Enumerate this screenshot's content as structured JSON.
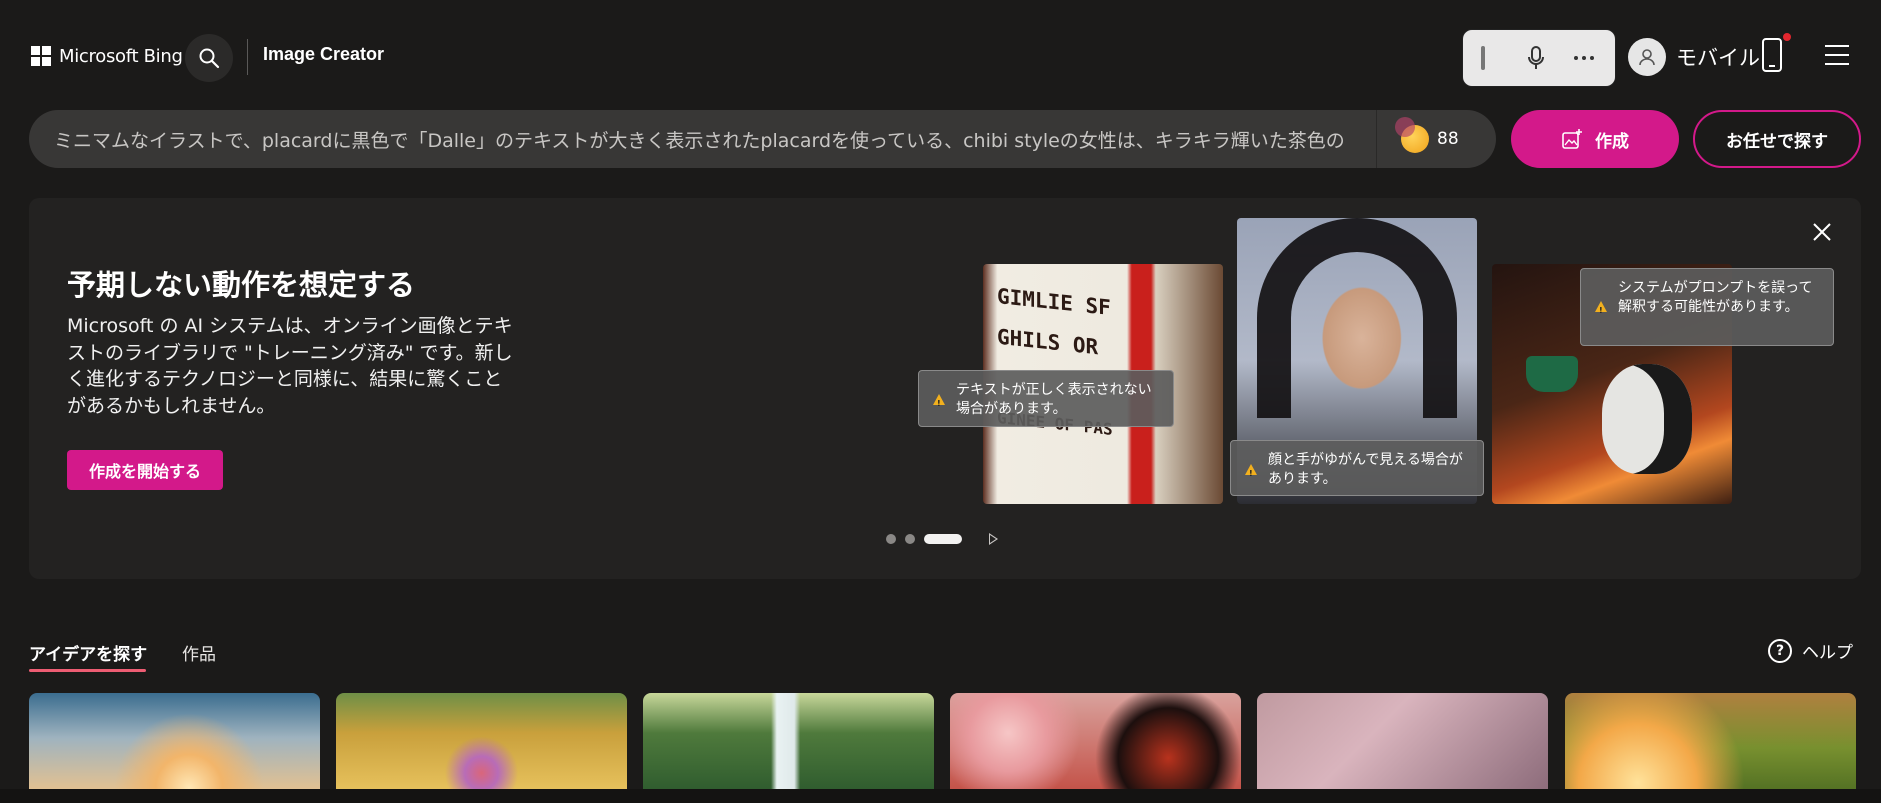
{
  "header": {
    "brand": "Microsoft Bing",
    "product": "Image Creator",
    "user_label": "モバイル"
  },
  "prompt_bar": {
    "text": "ミニマムなイラストで、placardに黒色で「Dalle」のテキストが大きく表示されたplacardを使っている、chibi styleの女性は、キラキラ輝いた茶色の",
    "boost_count": "88",
    "create_label": "作成",
    "surprise_label": "お任せで探す"
  },
  "hero": {
    "title": "予期しない動作を想定する",
    "body": "Microsoft の AI システムは、オンライン画像とテキストのライブラリで \"トレーニング済み\" です。新しく進化するテクノロジーと同様に、結果に驚くことがあるかもしれません。",
    "cta": "作成を開始する",
    "callouts": [
      "テキストが正しく表示されない場合があります。",
      "顔と手がゆがんで見える場合があります。",
      "システムがプロンプトを誤って解釈する可能性があります。"
    ],
    "sample_text": [
      "GIMLIE SF",
      "GHILS OR",
      "GINEE OF PAS"
    ],
    "carousel": {
      "count": 3,
      "active_index": 2
    }
  },
  "tabs": [
    {
      "label": "アイデアを探す",
      "active": true
    },
    {
      "label": "作品",
      "active": false
    }
  ],
  "help_label": "ヘルプ",
  "colors": {
    "accent": "#d3198a",
    "tab_underline": "#ee5d73",
    "background": "#1b1a19",
    "panel": "#232221"
  },
  "icons": [
    "windows-logo-icon",
    "search-icon",
    "microphone-icon",
    "more-icon",
    "user-icon",
    "phone-icon",
    "menu-icon",
    "image-create-icon",
    "coin-icon",
    "close-icon",
    "warning-icon",
    "play-icon",
    "help-icon"
  ]
}
